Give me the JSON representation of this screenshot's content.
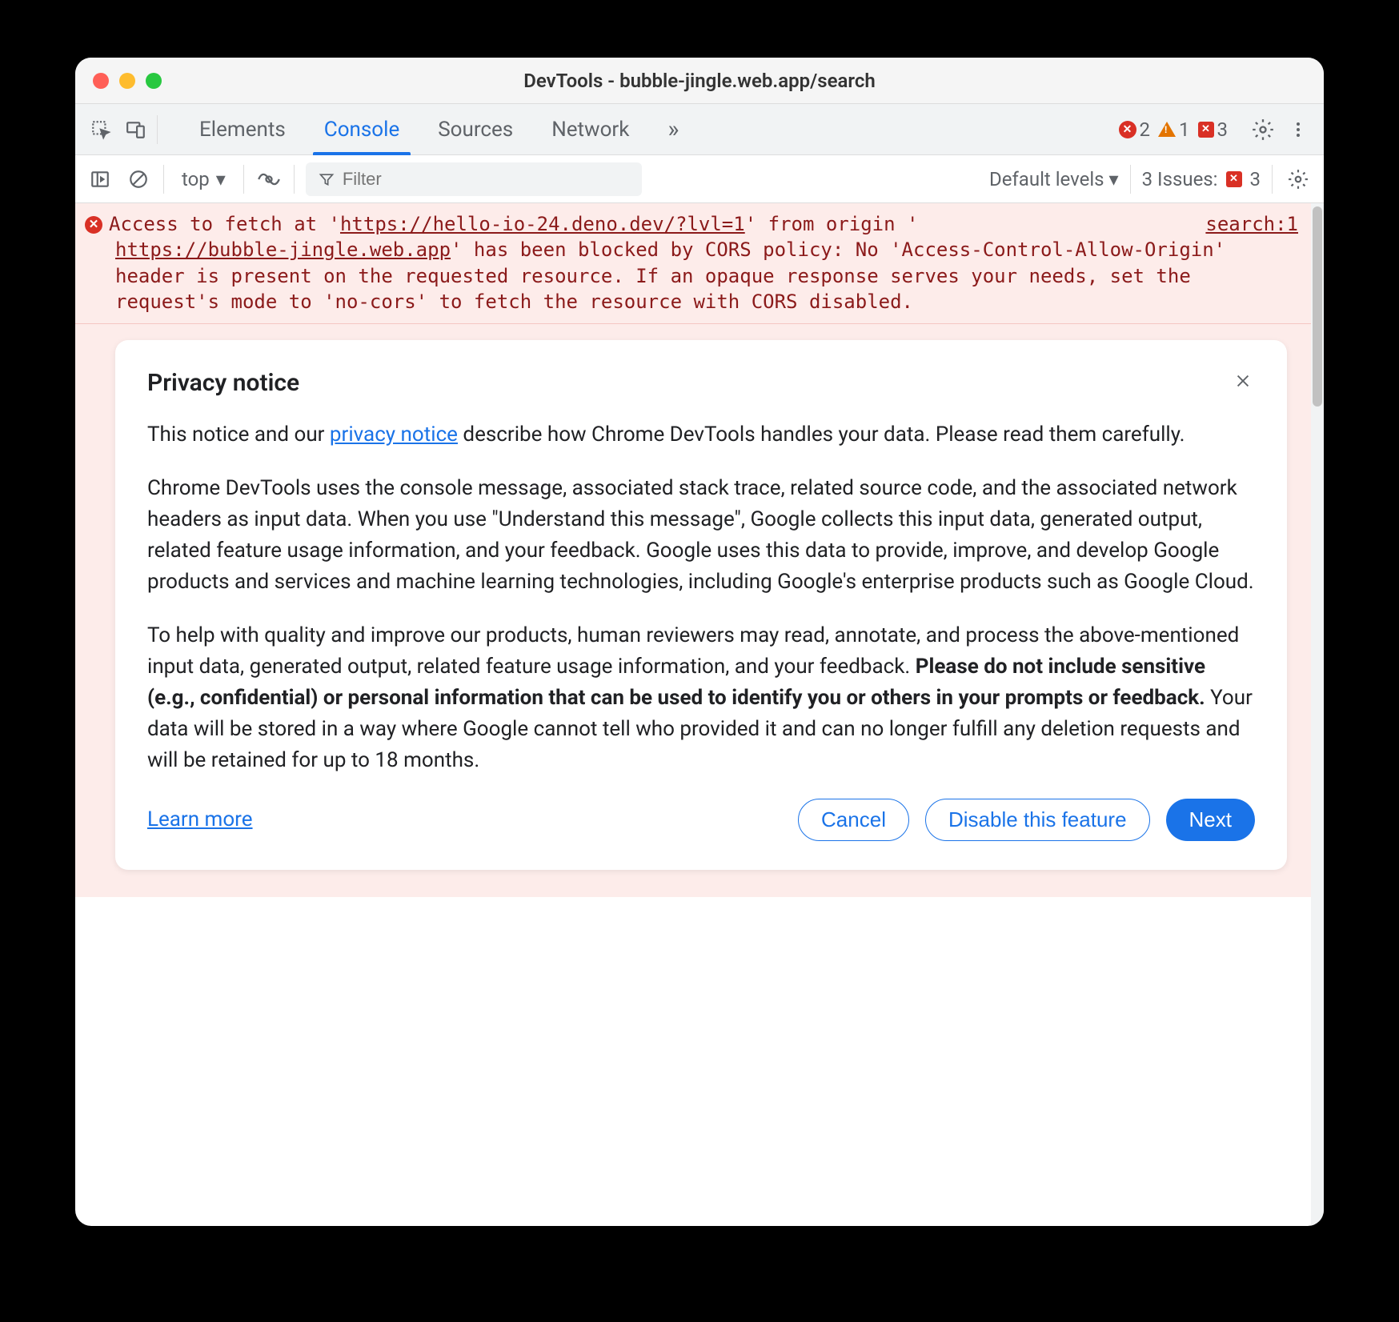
{
  "window": {
    "title": "DevTools - bubble-jingle.web.app/search"
  },
  "tabs": {
    "items": [
      "Elements",
      "Console",
      "Sources",
      "Network"
    ],
    "active": "Console",
    "more_glyph": "»"
  },
  "status": {
    "errors": "2",
    "warnings": "1",
    "messages": "3"
  },
  "toolbar": {
    "context": "top",
    "filter_placeholder": "Filter",
    "levels": "Default levels",
    "issues_label": "3 Issues:",
    "issues_count": "3"
  },
  "log": {
    "error": {
      "prefix": "Access to fetch at '",
      "url1": "https://hello-io-24.deno.dev/?lvl=1",
      "mid1": "' from origin '",
      "url2": "https://bubble-jingle.web.app",
      "rest": "' has been blocked by CORS policy: No 'Access-Control-Allow-Origin' header is present on the requested resource. If an opaque response serves your needs, set the request's mode to 'no-cors' to fetch the resource with CORS disabled.",
      "source": "search:1"
    }
  },
  "privacy": {
    "title": "Privacy notice",
    "intro_1": "This notice and our ",
    "intro_link": "privacy notice",
    "intro_2": " describe how Chrome DevTools handles your data. Please read them carefully.",
    "p2": "Chrome DevTools uses the console message, associated stack trace, related source code, and the associated network headers as input data. When you use \"Understand this message\", Google collects this input data, generated output, related feature usage information, and your feedback. Google uses this data to provide, improve, and develop Google products and services and machine learning technologies, including Google's enterprise products such as Google Cloud.",
    "p3_a": "To help with quality and improve our products, human reviewers may read, annotate, and process the above-mentioned input data, generated output, related feature usage information, and your feedback. ",
    "p3_bold": "Please do not include sensitive (e.g., confidential) or personal information that can be used to identify you or others in your prompts or feedback.",
    "p3_b": " Your data will be stored in a way where Google cannot tell who provided it and can no longer fulfill any deletion requests and will be retained for up to 18 months.",
    "learn_more": "Learn more",
    "cancel": "Cancel",
    "disable": "Disable this feature",
    "next": "Next"
  }
}
